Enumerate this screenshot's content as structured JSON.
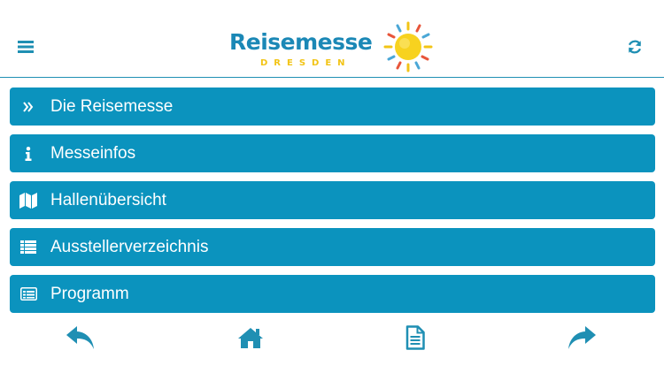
{
  "header": {
    "menu_icon": "hamburger-icon",
    "refresh_icon": "refresh-icon",
    "logo": {
      "title": "Reisemesse",
      "subtitle": "DRESDEN"
    }
  },
  "menu": {
    "items": [
      {
        "label": "Die Reisemesse",
        "icon": "double-chevron-right-icon"
      },
      {
        "label": "Messeinfos",
        "icon": "info-icon"
      },
      {
        "label": "Hallenübersicht",
        "icon": "map-icon"
      },
      {
        "label": "Ausstellerverzeichnis",
        "icon": "list-icon"
      },
      {
        "label": "Programm",
        "icon": "calendar-list-icon"
      }
    ]
  },
  "footer": {
    "icons": [
      "back-icon",
      "home-icon",
      "document-icon",
      "forward-icon"
    ]
  },
  "colors": {
    "accent": "#0b93be",
    "brand_blue": "#1b88b6",
    "brand_yellow": "#f2c416",
    "icon_blue": "#1f8fb3"
  }
}
